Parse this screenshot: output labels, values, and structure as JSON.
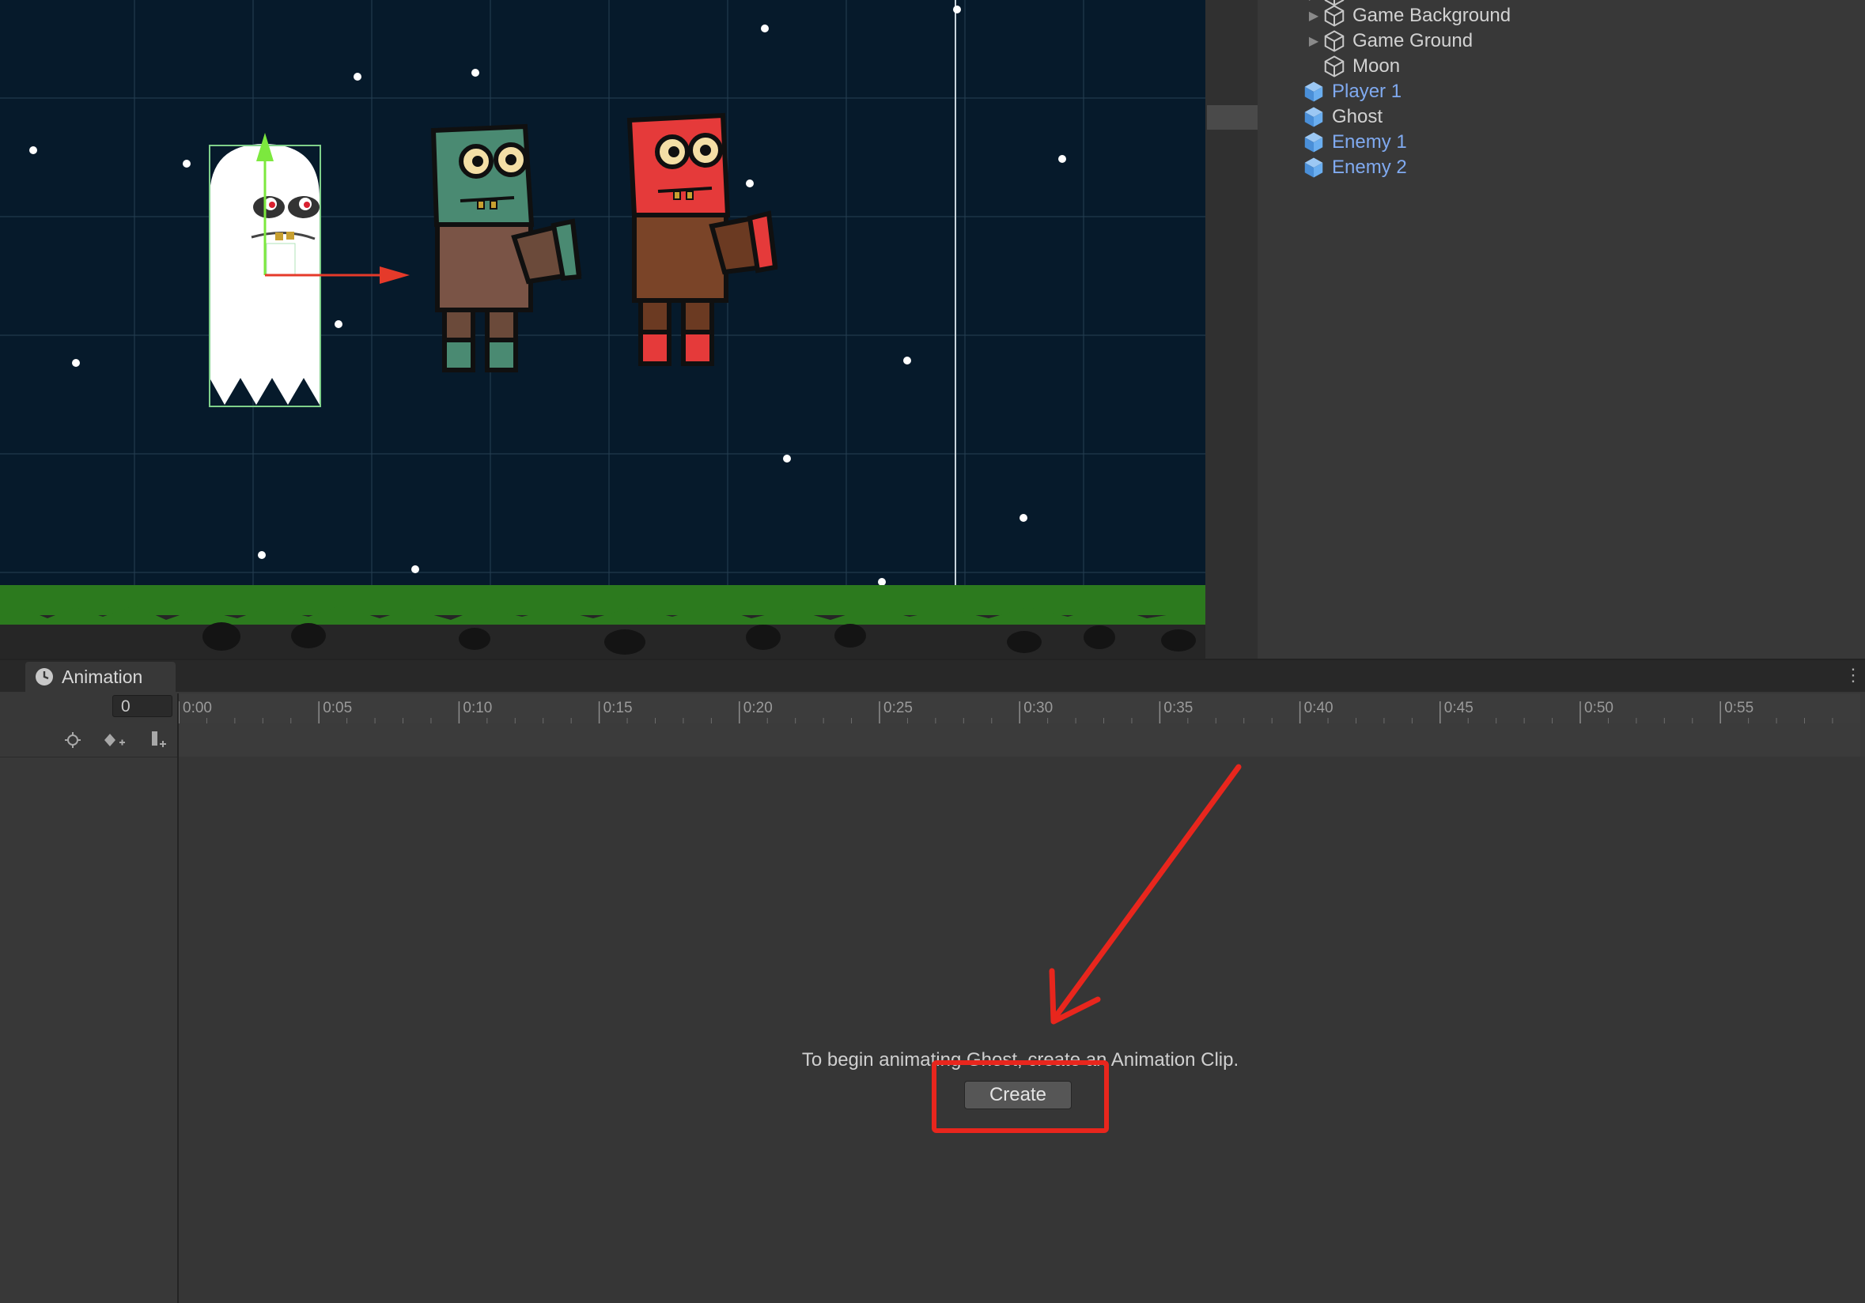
{
  "hierarchy": {
    "items": [
      {
        "label": "Game Background",
        "expandable": true,
        "prefab": false
      },
      {
        "label": "Game Ground",
        "expandable": true,
        "prefab": false
      },
      {
        "label": "Moon",
        "expandable": false,
        "prefab": false
      },
      {
        "label": "Player 1",
        "expandable": false,
        "prefab": true
      },
      {
        "label": "Ghost",
        "expandable": false,
        "prefab": true,
        "selected": true
      },
      {
        "label": "Enemy 1",
        "expandable": false,
        "prefab": true
      },
      {
        "label": "Enemy 2",
        "expandable": false,
        "prefab": true
      }
    ]
  },
  "animation": {
    "tab_label": "Animation",
    "frame_value": "0",
    "timeline_labels": [
      "0:00",
      "0:05",
      "0:10",
      "0:15",
      "0:20",
      "0:25",
      "0:30",
      "0:35",
      "0:40",
      "0:45",
      "0:50",
      "0:55"
    ],
    "empty_message": "To begin animating Ghost, create an Animation Clip.",
    "create_label": "Create"
  },
  "colors": {
    "scene_bg": "#061a2b",
    "prefab_text": "#80aaf0",
    "annotation_red": "#e8261d"
  }
}
